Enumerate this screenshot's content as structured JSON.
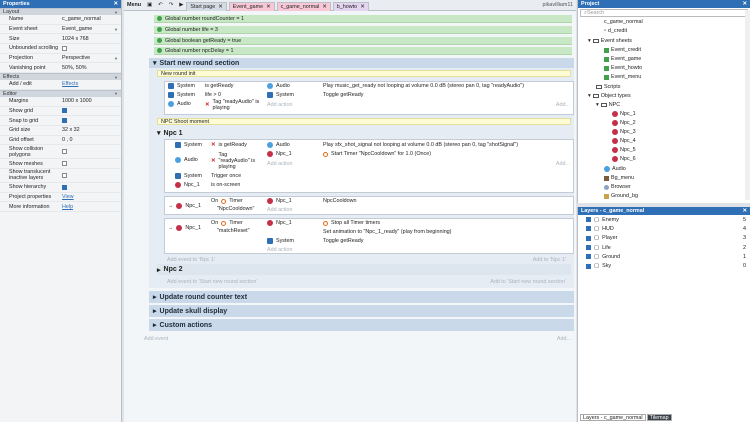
{
  "properties": {
    "title": "Properties",
    "sections": {
      "layout": "Layout",
      "effects": "Effects",
      "editor": "Editor"
    },
    "rows": {
      "name_k": "Name",
      "name_v": "c_game_normal",
      "sheet_k": "Event sheet",
      "sheet_v": "Event_game",
      "size_k": "Size",
      "size_v": "1024 x 768",
      "unb_k": "Unbounded scrolling",
      "proj_k": "Projection",
      "proj_v": "Perspective",
      "van_k": "Vanishing point",
      "van_v": "50%, 50%",
      "addedit_k": "Add / edit",
      "addedit_v": "Effects",
      "margins_k": "Margins",
      "margins_v": "1000 x 1000",
      "sgrid_k": "Show grid",
      "snap_k": "Snap to grid",
      "gsize_k": "Grid size",
      "gsize_v": "32 x 32",
      "goff_k": "Grid offset",
      "goff_v": "0 , 0",
      "coll_k": "Show collision polygons",
      "mesh_k": "Show meshes",
      "trans_k": "Show translucent inactive layers",
      "hier_k": "Show hierarchy",
      "pp_k": "Project properties",
      "pp_v": "View",
      "mi_k": "More information",
      "mi_v": "Help"
    }
  },
  "toolbar": {
    "menu": "Menu",
    "tabs": [
      "Start page",
      "Event_game",
      "c_game_normal",
      "b_howto"
    ],
    "user": "pikavilliam11"
  },
  "events": {
    "globals": [
      "Global number roundCounter = 1",
      "Global number life = 3",
      "Global boolean getReady = true",
      "Global number npcDelay = 1"
    ],
    "group1": "Start new round section",
    "cmt_round": "New round init",
    "cmt_npc": "NPC Shoot moment",
    "c_sys": "System",
    "c_audio": "Audio",
    "c_is": "is getReady",
    "c_life": "life > 0",
    "c_tag": "Tag \"readyAudio\" is playing",
    "a_play": "Play music_get_ready not looping at volume 0.0 dB (stereo pan 0, tag \"readyAudio\")",
    "a_toggle": "Toggle getReady",
    "sub_npc1": "Npc 1",
    "c_trig": "Trigger once",
    "c_onscreen": "is on-screen",
    "c_npc1": "Npc_1",
    "a_play2": "Play sfx_shot_signal not looping at volume 0.0 dB (stereo pan 0, tag \"shotSignal\")",
    "a_timer": "Start Timer \"NpcCooldown\" for 1.0 (Once)",
    "c_on": "On",
    "c_timer": "Timer",
    "c_tname1": "\"NpcCooldown\"",
    "a_npccd": "NpcCooldown",
    "c_tname2": "\"matchReset\"",
    "a_stop": "Stop all Timer timers",
    "a_anim": "Set animation to \"Npc_1_ready\" (play from beginning)",
    "a_toggle2": "Toggle getReady",
    "add_action": "Add action",
    "add_npc1": "Add event to 'Npc 1'",
    "add_npc1_r": "Add to 'Npc 1'",
    "sub_npc2": "Npc 2",
    "add_start": "Add event to 'Start new round section'",
    "add_start_r": "Add to 'Start new round section'",
    "g2": "Update round counter text",
    "g3": "Update skull display",
    "g4": "Custom actions",
    "add_event": "Add event",
    "add_dots": "Add..."
  },
  "project": {
    "title": "Project",
    "search": "Search",
    "items": [
      "c_game_normal",
      "d_credit",
      "Event sheets",
      "Event_credit",
      "Event_game",
      "Event_howto",
      "Event_menu",
      "Scripts",
      "Object types",
      "NPC",
      "Npc_1",
      "Npc_2",
      "Npc_3",
      "Npc_4",
      "Npc_5",
      "Npc_6",
      "Audio",
      "Bg_menu",
      "Browser",
      "Ground_bg"
    ]
  },
  "layers": {
    "title": "Layers - c_game_normal",
    "rows": [
      {
        "name": "Enemy",
        "n": "5"
      },
      {
        "name": "HUD",
        "n": "4"
      },
      {
        "name": "Player",
        "n": "3"
      },
      {
        "name": "Life",
        "n": "2"
      },
      {
        "name": "Ground",
        "n": "1"
      },
      {
        "name": "Sky",
        "n": "0"
      }
    ],
    "tab1": "Layers - c_game_normal",
    "tab2": "Tilemap"
  },
  "colors": {
    "accent": "#2f6fb5",
    "group": "#cad9ea",
    "global": "#c8e8c5",
    "comment": "#fdfbd3"
  }
}
